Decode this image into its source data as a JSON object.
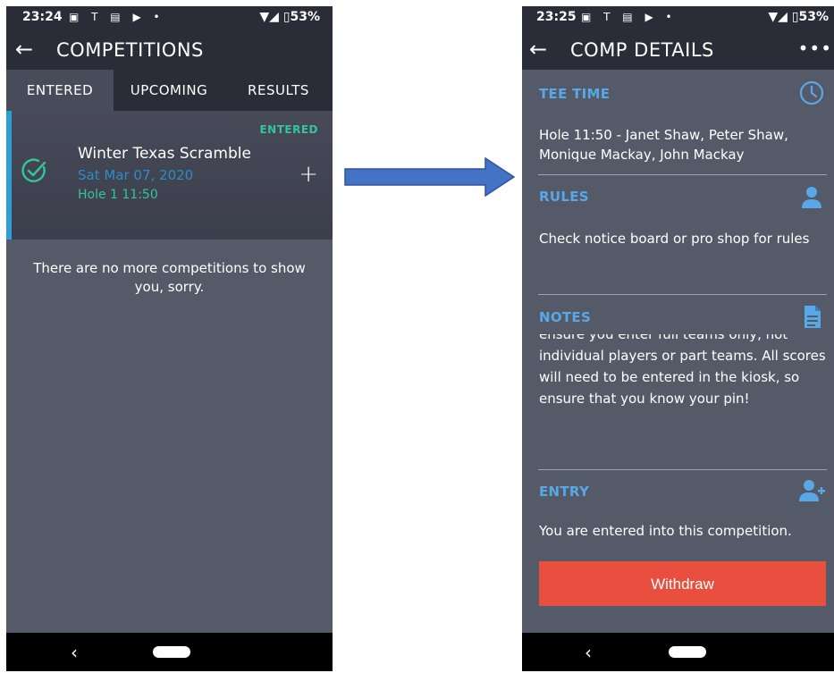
{
  "left": {
    "status": {
      "time": "23:24",
      "icons": "▣ T ▤ ▶ •",
      "battery": "▼◢ ▯53%"
    },
    "appbar": {
      "title": "COMPETITIONS"
    },
    "tabs": [
      {
        "label": "ENTERED"
      },
      {
        "label": "UPCOMING"
      },
      {
        "label": "RESULTS"
      }
    ],
    "card": {
      "badge": "ENTERED",
      "name": "Winter Texas Scramble",
      "date": "Sat Mar 07, 2020",
      "hole": "Hole 1 11:50"
    },
    "empty_message": "There are no more competitions to show you, sorry."
  },
  "right": {
    "status": {
      "time": "23:25",
      "icons": "▣ T ▤ ▶ •",
      "battery": "▼◢ ▯53%"
    },
    "appbar": {
      "title": "COMP DETAILS",
      "more": "•••"
    },
    "tee_time": {
      "label": "TEE TIME",
      "text": "Hole 11:50 - Janet Shaw, Peter Shaw, Monique Mackay, John Mackay"
    },
    "rules": {
      "label": "RULES",
      "text": "Check notice board or pro shop for rules"
    },
    "notes": {
      "label": "NOTES",
      "text": "ensure you enter full teams only, not individual players or part teams. All scores will need to be entered in the kiosk, so ensure that you know your pin!"
    },
    "entry": {
      "label": "ENTRY",
      "text": "You are entered into this competition.",
      "withdraw_label": "Withdraw"
    }
  },
  "nav": {
    "back": "‹"
  },
  "colors": {
    "accent_blue": "#58a8e8",
    "entered_green": "#35c49c",
    "withdraw_red": "#e84f3e",
    "arrow_blue": "#4472c4"
  }
}
